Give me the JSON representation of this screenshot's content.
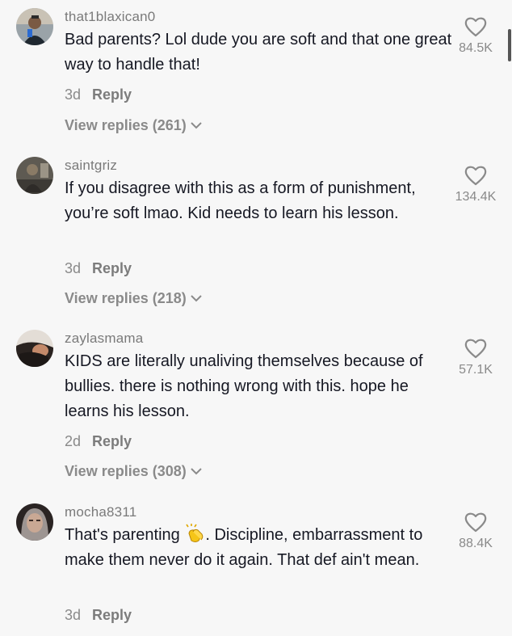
{
  "comments": [
    {
      "username": "that1blaxican0",
      "text": "Bad parents? Lol dude you are soft and that one great way to handle that!",
      "age": "3d",
      "reply_label": "Reply",
      "view_replies": "View replies (261)",
      "likes": "84.5K",
      "avatar_icon": "avatar-man-selfie-icon"
    },
    {
      "username": "saintgriz",
      "text": "If you disagree with this as a form of punishment, you’re soft lmao. Kid needs to learn his lesson.",
      "age": "3d",
      "reply_label": "Reply",
      "view_replies": "View replies (218)",
      "likes": "134.4K",
      "avatar_icon": "avatar-person-photo-icon"
    },
    {
      "username": "zaylasmama",
      "text": "KIDS are literally unaliving themselves because of bullies. there is nothing wrong with this. hope he learns his lesson.",
      "age": "2d",
      "reply_label": "Reply",
      "view_replies": "View replies (308)",
      "likes": "57.1K",
      "avatar_icon": "avatar-woman-portrait-icon"
    },
    {
      "username": "mocha8311",
      "text_before": "That's parenting ",
      "text_after": ". Discipline, embarrassment to make them never do it again. That def ain't mean.",
      "age": "3d",
      "reply_label": "Reply",
      "likes": "88.4K",
      "avatar_icon": "avatar-woman-selfie-icon",
      "emoji_icon": "clapping-hands-icon"
    }
  ],
  "colors": {
    "background": "#f7f7f7",
    "text": "#161823",
    "muted": "#8a8a8a"
  }
}
